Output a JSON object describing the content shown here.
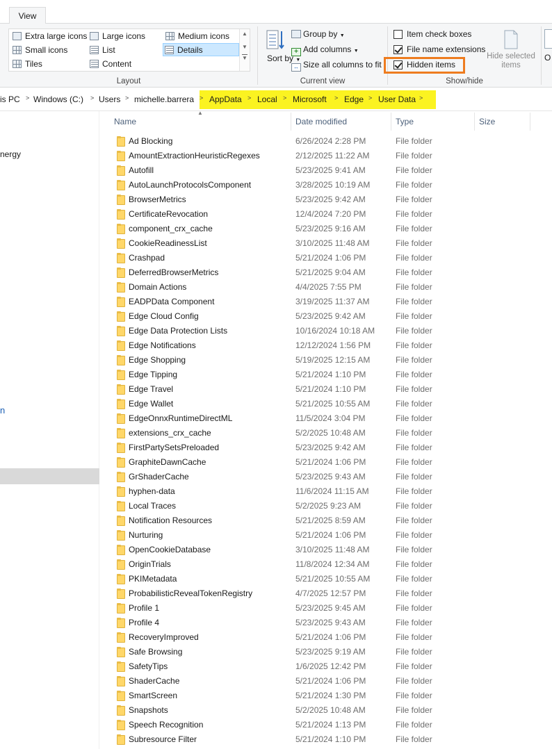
{
  "ribbon": {
    "active_tab": "View",
    "layout": {
      "label": "Layout",
      "items": [
        "Extra large icons",
        "Large icons",
        "Medium icons",
        "Small icons",
        "List",
        "Details",
        "Tiles",
        "Content"
      ],
      "selected": "Details"
    },
    "current_view": {
      "label": "Current view",
      "sort_by": "Sort by",
      "group_by": "Group by",
      "add_columns": "Add columns",
      "size_columns": "Size all columns to fit"
    },
    "show_hide": {
      "label": "Show/hide",
      "item_check_boxes": {
        "label": "Item check boxes",
        "checked": false
      },
      "file_name_extensions": {
        "label": "File name extensions",
        "checked": true
      },
      "hidden_items": {
        "label": "Hidden items",
        "checked": true
      },
      "hide_selected": "Hide selected items",
      "options_partial": "O"
    }
  },
  "breadcrumb": [
    "is PC",
    "Windows (C:)",
    "Users",
    "michelle.barrera",
    "AppData",
    "Local",
    "Microsoft",
    "Edge",
    "User Data"
  ],
  "nav": {
    "partial_item": "nergy",
    "partial_glyph": "n"
  },
  "columns": {
    "name": "Name",
    "date": "Date modified",
    "type": "Type",
    "size": "Size"
  },
  "files": [
    {
      "name": "Ad Blocking",
      "date": "6/26/2024 2:28 PM",
      "type": "File folder"
    },
    {
      "name": "AmountExtractionHeuristicRegexes",
      "date": "2/12/2025 11:22 AM",
      "type": "File folder"
    },
    {
      "name": "Autofill",
      "date": "5/23/2025 9:41 AM",
      "type": "File folder"
    },
    {
      "name": "AutoLaunchProtocolsComponent",
      "date": "3/28/2025 10:19 AM",
      "type": "File folder"
    },
    {
      "name": "BrowserMetrics",
      "date": "5/23/2025 9:42 AM",
      "type": "File folder"
    },
    {
      "name": "CertificateRevocation",
      "date": "12/4/2024 7:20 PM",
      "type": "File folder"
    },
    {
      "name": "component_crx_cache",
      "date": "5/23/2025 9:16 AM",
      "type": "File folder"
    },
    {
      "name": "CookieReadinessList",
      "date": "3/10/2025 11:48 AM",
      "type": "File folder"
    },
    {
      "name": "Crashpad",
      "date": "5/21/2024 1:06 PM",
      "type": "File folder"
    },
    {
      "name": "DeferredBrowserMetrics",
      "date": "5/21/2025 9:04 AM",
      "type": "File folder"
    },
    {
      "name": "Domain Actions",
      "date": "4/4/2025 7:55 PM",
      "type": "File folder"
    },
    {
      "name": "EADPData Component",
      "date": "3/19/2025 11:37 AM",
      "type": "File folder"
    },
    {
      "name": "Edge Cloud Config",
      "date": "5/23/2025 9:42 AM",
      "type": "File folder"
    },
    {
      "name": "Edge Data Protection Lists",
      "date": "10/16/2024 10:18 AM",
      "type": "File folder"
    },
    {
      "name": "Edge Notifications",
      "date": "12/12/2024 1:56 PM",
      "type": "File folder"
    },
    {
      "name": "Edge Shopping",
      "date": "5/19/2025 12:15 AM",
      "type": "File folder"
    },
    {
      "name": "Edge Tipping",
      "date": "5/21/2024 1:10 PM",
      "type": "File folder"
    },
    {
      "name": "Edge Travel",
      "date": "5/21/2024 1:10 PM",
      "type": "File folder"
    },
    {
      "name": "Edge Wallet",
      "date": "5/21/2025 10:55 AM",
      "type": "File folder"
    },
    {
      "name": "EdgeOnnxRuntimeDirectML",
      "date": "11/5/2024 3:04 PM",
      "type": "File folder"
    },
    {
      "name": "extensions_crx_cache",
      "date": "5/2/2025 10:48 AM",
      "type": "File folder"
    },
    {
      "name": "FirstPartySetsPreloaded",
      "date": "5/23/2025 9:42 AM",
      "type": "File folder"
    },
    {
      "name": "GraphiteDawnCache",
      "date": "5/21/2024 1:06 PM",
      "type": "File folder"
    },
    {
      "name": "GrShaderCache",
      "date": "5/23/2025 9:43 AM",
      "type": "File folder"
    },
    {
      "name": "hyphen-data",
      "date": "11/6/2024 11:15 AM",
      "type": "File folder"
    },
    {
      "name": "Local Traces",
      "date": "5/2/2025 9:23 AM",
      "type": "File folder"
    },
    {
      "name": "Notification Resources",
      "date": "5/21/2025 8:59 AM",
      "type": "File folder"
    },
    {
      "name": "Nurturing",
      "date": "5/21/2024 1:06 PM",
      "type": "File folder"
    },
    {
      "name": "OpenCookieDatabase",
      "date": "3/10/2025 11:48 AM",
      "type": "File folder"
    },
    {
      "name": "OriginTrials",
      "date": "11/8/2024 12:34 AM",
      "type": "File folder"
    },
    {
      "name": "PKIMetadata",
      "date": "5/21/2025 10:55 AM",
      "type": "File folder"
    },
    {
      "name": "ProbabilisticRevealTokenRegistry",
      "date": "4/7/2025 12:57 PM",
      "type": "File folder"
    },
    {
      "name": "Profile 1",
      "date": "5/23/2025 9:45 AM",
      "type": "File folder"
    },
    {
      "name": "Profile 4",
      "date": "5/23/2025 9:43 AM",
      "type": "File folder"
    },
    {
      "name": "RecoveryImproved",
      "date": "5/21/2024 1:06 PM",
      "type": "File folder"
    },
    {
      "name": "Safe Browsing",
      "date": "5/23/2025 9:19 AM",
      "type": "File folder"
    },
    {
      "name": "SafetyTips",
      "date": "1/6/2025 12:42 PM",
      "type": "File folder"
    },
    {
      "name": "ShaderCache",
      "date": "5/21/2024 1:06 PM",
      "type": "File folder"
    },
    {
      "name": "SmartScreen",
      "date": "5/21/2024 1:30 PM",
      "type": "File folder"
    },
    {
      "name": "Snapshots",
      "date": "5/2/2025 10:48 AM",
      "type": "File folder"
    },
    {
      "name": "Speech Recognition",
      "date": "5/21/2024 1:13 PM",
      "type": "File folder"
    },
    {
      "name": "Subresource Filter",
      "date": "5/21/2024 1:10 PM",
      "type": "File folder"
    }
  ],
  "colors": {
    "highlight": "#fbf321",
    "focus_outline": "#ee7c1f",
    "selection": "#cce8ff",
    "folder": "#ffd769"
  }
}
